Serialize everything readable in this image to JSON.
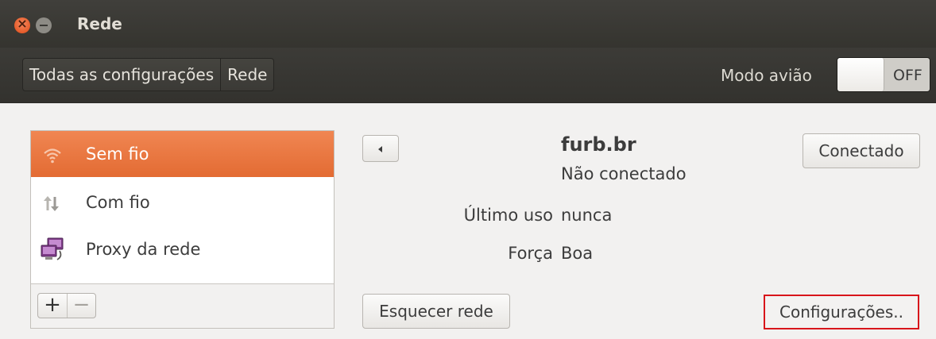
{
  "window": {
    "title": "Rede"
  },
  "toolbar": {
    "breadcrumbs": [
      "Todas as configurações",
      "Rede"
    ],
    "airplane_label": "Modo avião",
    "airplane_state": "OFF"
  },
  "sidebar": {
    "items": [
      {
        "label": "Sem fio",
        "icon": "wifi-icon",
        "selected": true
      },
      {
        "label": "Com fio",
        "icon": "wired-icon",
        "selected": false
      },
      {
        "label": "Proxy da rede",
        "icon": "proxy-icon",
        "selected": false
      }
    ],
    "add_label": "+",
    "remove_label": "−"
  },
  "detail": {
    "network_name": "furb.br",
    "network_status": "Não conectado",
    "connect_label": "Conectado",
    "last_used_label": "Último uso",
    "last_used_value": "nunca",
    "strength_label": "Força",
    "strength_value": "Boa",
    "forget_label": "Esquecer rede",
    "settings_label": "Configurações.."
  },
  "colors": {
    "accent": "#e8713a",
    "highlight_border": "#d8151b",
    "titlebar": "#3c3b37"
  }
}
